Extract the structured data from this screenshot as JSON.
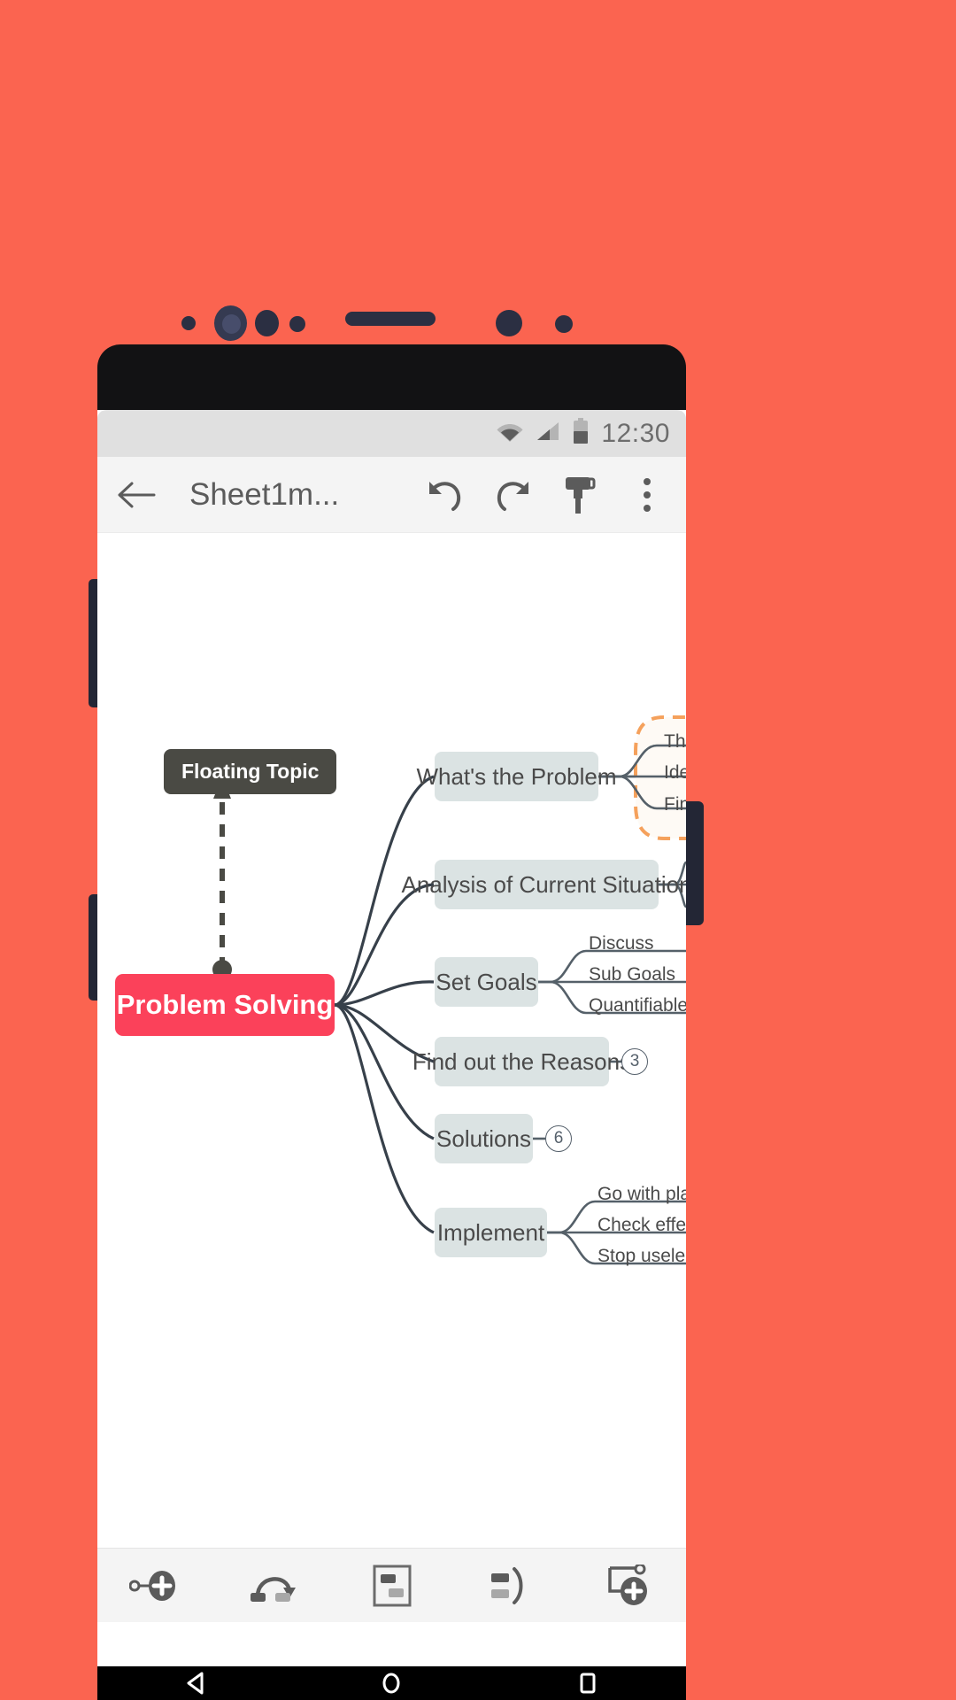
{
  "device": {
    "status_bar": {
      "time": "12:30",
      "icons": [
        "wifi-icon",
        "signal-icon",
        "battery-icon"
      ]
    },
    "nav_bar": {
      "back_label": "back-triangle-icon",
      "home_label": "home-circle-icon",
      "recents_label": "recents-square-icon"
    }
  },
  "toolbar": {
    "back_icon": "back-arrow-icon",
    "title": "Sheet1m...",
    "undo_icon": "undo-icon",
    "redo_icon": "redo-icon",
    "format_icon": "format-painter-icon",
    "overflow_icon": "more-vertical-icon"
  },
  "mindmap": {
    "root": {
      "label": "Problem Solving",
      "color": "#fb415a"
    },
    "floating": {
      "label": "Floating Topic",
      "color": "#4a4a44"
    },
    "branch_color": "#dbe3e3",
    "boundary_color": "#f5a15c",
    "branches": [
      {
        "label": "What's the Problem",
        "badge": null,
        "subtopics": [
          "Th",
          "Ide",
          "Fin"
        ],
        "boundary": true
      },
      {
        "label": "Analysis of Current Situation",
        "badge": null,
        "subtopics": [],
        "boundary": false
      },
      {
        "label": "Set Goals",
        "badge": null,
        "subtopics": [
          "Discuss",
          "Sub Goals",
          "Quantifiable targe"
        ],
        "boundary": false
      },
      {
        "label": "Find out the Reasons",
        "badge": "3",
        "subtopics": [],
        "boundary": false
      },
      {
        "label": "Solutions",
        "badge": "6",
        "subtopics": [],
        "boundary": false
      },
      {
        "label": "Implement",
        "badge": null,
        "subtopics": [
          "Go with plans",
          "Check effect of",
          "Stop useless so"
        ],
        "boundary": false
      }
    ]
  },
  "bottom_toolbar": {
    "items": [
      {
        "icon": "add-sibling-topic-icon"
      },
      {
        "icon": "relationship-icon"
      },
      {
        "icon": "boundary-icon"
      },
      {
        "icon": "summary-icon"
      },
      {
        "icon": "add-floating-topic-icon"
      }
    ]
  }
}
